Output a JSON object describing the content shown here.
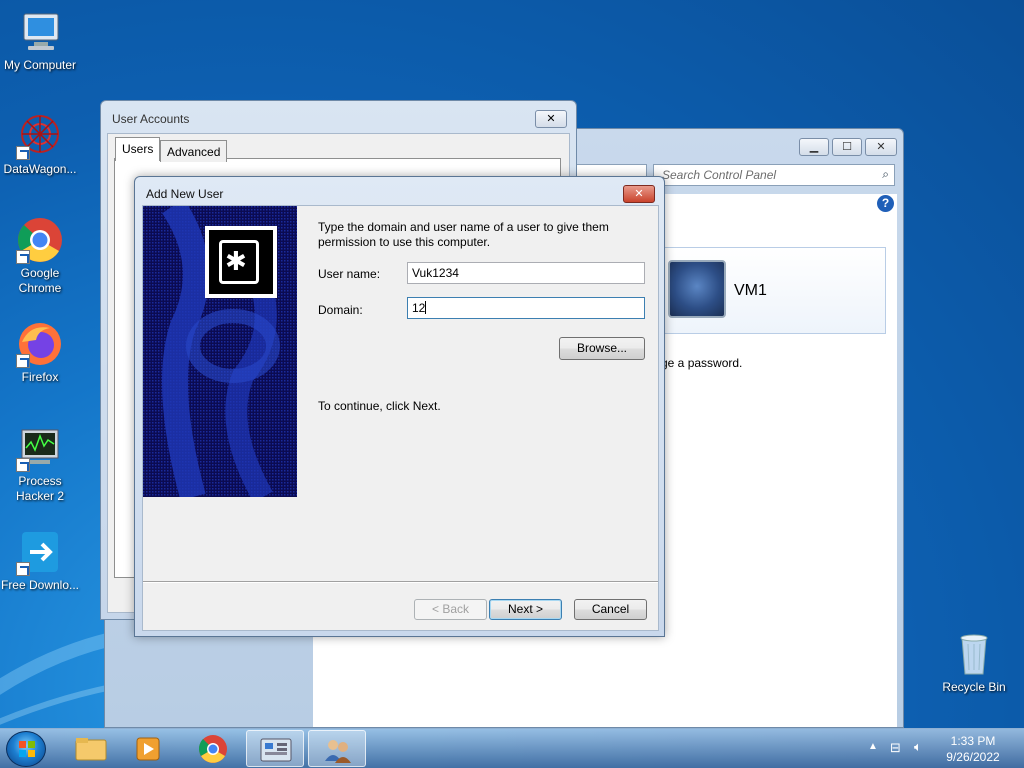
{
  "desktop": {
    "icons": [
      {
        "label": "My Computer"
      },
      {
        "label": "DataWagon..."
      },
      {
        "label": "Google Chrome"
      },
      {
        "label": "Firefox"
      },
      {
        "label": "Process Hacker 2"
      },
      {
        "label": "Free Downlo..."
      },
      {
        "label": "Recycle Bin"
      }
    ]
  },
  "control_panel": {
    "search_placeholder": "Search Control Panel",
    "user_name": "VM1",
    "change_password_text": "ge a password.",
    "help": "?"
  },
  "user_accounts": {
    "title": "User Accounts",
    "tabs": [
      "Users",
      "Advanced"
    ],
    "close_glyph": "✕"
  },
  "add_new_user": {
    "title": "Add New User",
    "close_glyph": "✕",
    "instruction": "Type the domain and user name of a user to give them permission to use this computer.",
    "user_name_label": "User name:",
    "user_name_value": "Vuk1234",
    "domain_label": "Domain:",
    "domain_value": "12",
    "browse_label": "Browse...",
    "continue_text": "To continue, click Next.",
    "back_label": "< Back",
    "next_label": "Next >",
    "cancel_label": "Cancel"
  },
  "taskbar": {
    "time": "1:33 PM",
    "date": "9/26/2022"
  }
}
